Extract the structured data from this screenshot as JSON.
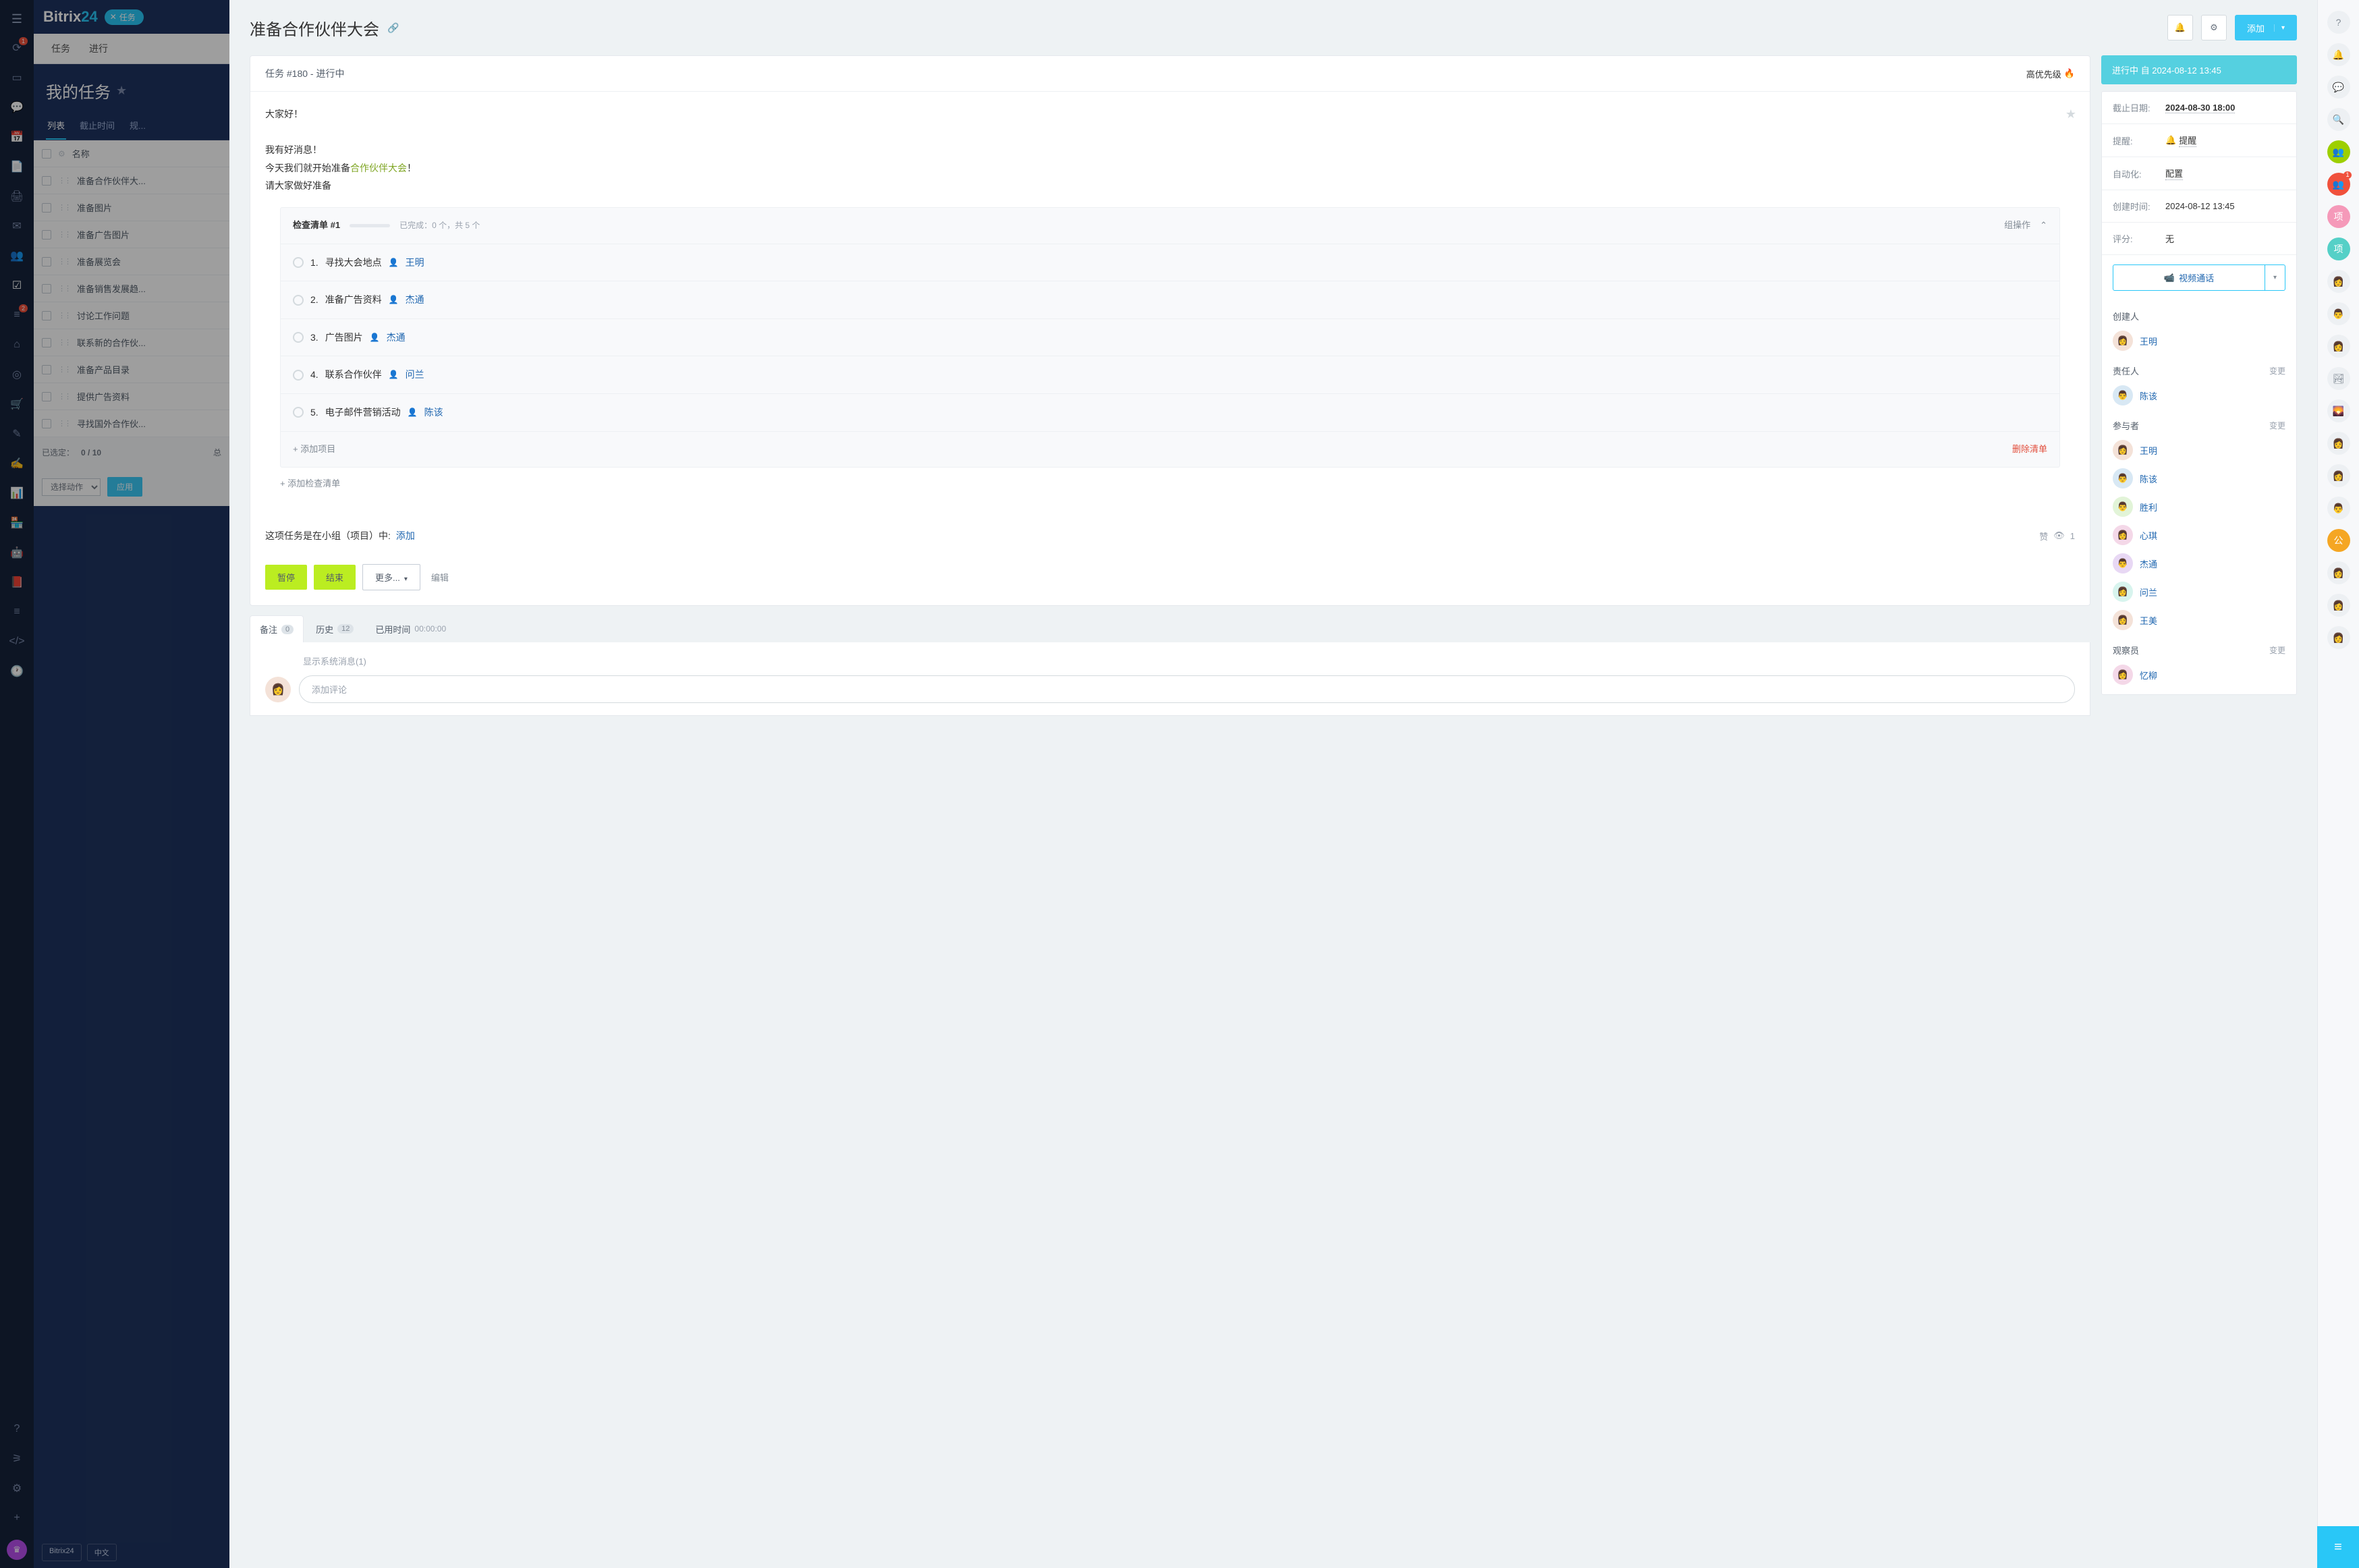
{
  "brand": {
    "name1": "Bitrix",
    "name2": "24",
    "chip_close": "✕",
    "chip_label": "任务"
  },
  "leftnav": {
    "badges": {
      "feed": "1",
      "filter": "2"
    }
  },
  "topnav": {
    "tabs": [
      "任务",
      "进行"
    ]
  },
  "page_title": "我的任务",
  "subtabs": [
    "列表",
    "截止时间",
    "规..."
  ],
  "task_table": {
    "header": "名称",
    "rows": [
      "准备合作伙伴大...",
      "准备图片",
      "准备广告图片",
      "准备展览会",
      "准备销售发展趋...",
      "讨论工作问题",
      "联系新的合作伙...",
      "准备产品目录",
      "提供广告资料",
      "寻找国外合作伙..."
    ],
    "selected": "已选定：",
    "selected_count": "0 / 10",
    "total": "总",
    "action_sel": "选择动作",
    "apply": "应用"
  },
  "footer_tags": {
    "brand": "Bitrix24",
    "lang": "中文"
  },
  "task": {
    "title": "准备合作伙伴大会",
    "add_label": "添加",
    "header": "任务 #180 - 进行中",
    "priority": "高优先级",
    "body": {
      "l1": "大家好！",
      "l2": "我有好消息！",
      "l3a": "今天我们就开始准备",
      "l3b": "合作伙伴大会",
      "l3c": "！",
      "l4": "请大家做好准备"
    },
    "checklist": {
      "title": "检查清单 #1",
      "progress_text": "已完成：0 个，共 5 个",
      "ops": "组操作",
      "items": [
        {
          "n": "1.",
          "text": "寻找大会地点",
          "assignee": "王明"
        },
        {
          "n": "2.",
          "text": "准备广告资料",
          "assignee": "杰通"
        },
        {
          "n": "3.",
          "text": "广告图片",
          "assignee": "杰通"
        },
        {
          "n": "4.",
          "text": "联系合作伙伴",
          "assignee": "问兰"
        },
        {
          "n": "5.",
          "text": "电子邮件营销活动",
          "assignee": "陈该"
        }
      ],
      "add_item": "+ 添加项目",
      "delete": "删除清单",
      "add_checklist": "+ 添加检查清单"
    },
    "project": {
      "label": "这项任务是在小组（项目）中:",
      "add": "添加",
      "like": "赞",
      "views": "1"
    },
    "actions": {
      "pause": "暂停",
      "end": "结束",
      "more": "更多...",
      "edit": "编辑"
    },
    "tabs": {
      "comments": "备注",
      "comments_count": "0",
      "history": "历史",
      "history_count": "12",
      "spent": "已用时间",
      "spent_val": "00:00:00"
    },
    "comment_sys": "显示系统消息(1)",
    "comment_ph": "添加评论"
  },
  "side": {
    "status": "进行中 自 2024-08-12 13:45",
    "rows": {
      "deadline_l": "截止日期:",
      "deadline_v": "2024-08-30 18:00",
      "remind_l": "提醒:",
      "remind_v": "提醒",
      "auto_l": "自动化:",
      "auto_v": "配置",
      "created_l": "创建时间:",
      "created_v": "2024-08-12 13:45",
      "rating_l": "评分:",
      "rating_v": "无"
    },
    "video": "视频通话",
    "creator_h": "创建人",
    "creator": "王明",
    "responsible_h": "责任人",
    "responsible": "陈该",
    "participants_h": "参与者",
    "participants": [
      "王明",
      "陈该",
      "胜利",
      "心琪",
      "杰通",
      "问兰",
      "王美"
    ],
    "observer_h": "观察员",
    "observer": "忆柳",
    "change": "变更"
  },
  "rightbar": {
    "b1": "1"
  }
}
